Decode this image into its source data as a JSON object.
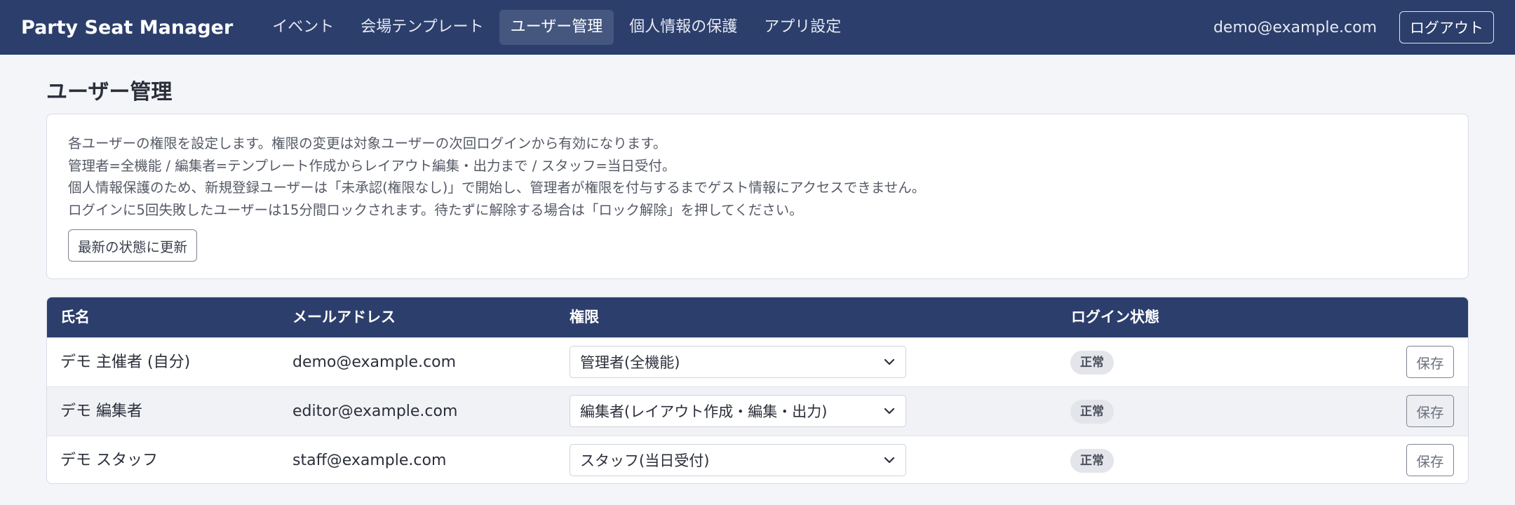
{
  "app": {
    "brand": "Party Seat Manager",
    "nav": [
      {
        "label": "イベント",
        "active": false
      },
      {
        "label": "会場テンプレート",
        "active": false
      },
      {
        "label": "ユーザー管理",
        "active": true
      },
      {
        "label": "個人情報の保護",
        "active": false
      },
      {
        "label": "アプリ設定",
        "active": false
      }
    ],
    "user_email": "demo@example.com",
    "logout_label": "ログアウト"
  },
  "page": {
    "title": "ユーザー管理",
    "info_lines": [
      "各ユーザーの権限を設定します。権限の変更は対象ユーザーの次回ログインから有効になります。",
      "管理者=全機能 / 編集者=テンプレート作成からレイアウト編集・出力まで / スタッフ=当日受付。",
      "個人情報保護のため、新規登録ユーザーは「未承認(権限なし)」で開始し、管理者が権限を付与するまでゲスト情報にアクセスできません。",
      "ログインに5回失敗したユーザーは15分間ロックされます。待たずに解除する場合は「ロック解除」を押してください。"
    ],
    "refresh_label": "最新の状態に更新"
  },
  "table": {
    "headers": {
      "name": "氏名",
      "email": "メールアドレス",
      "role": "権限",
      "status": "ログイン状態"
    },
    "rows": [
      {
        "name": "デモ 主催者 (自分)",
        "email": "demo@example.com",
        "role": "管理者(全機能)",
        "status": "正常",
        "save_label": "保存"
      },
      {
        "name": "デモ 編集者",
        "email": "editor@example.com",
        "role": "編集者(レイアウト作成・編集・出力)",
        "status": "正常",
        "save_label": "保存"
      },
      {
        "name": "デモ スタッフ",
        "email": "staff@example.com",
        "role": "スタッフ(当日受付)",
        "status": "正常",
        "save_label": "保存"
      }
    ]
  },
  "colors": {
    "nav_bg": "#2c3e6b",
    "nav_active_bg": "#45567f",
    "page_bg": "#f4f5f9",
    "badge_bg": "#e3e5ea"
  },
  "icons": {
    "select_arrow": "chevron-down-icon"
  }
}
